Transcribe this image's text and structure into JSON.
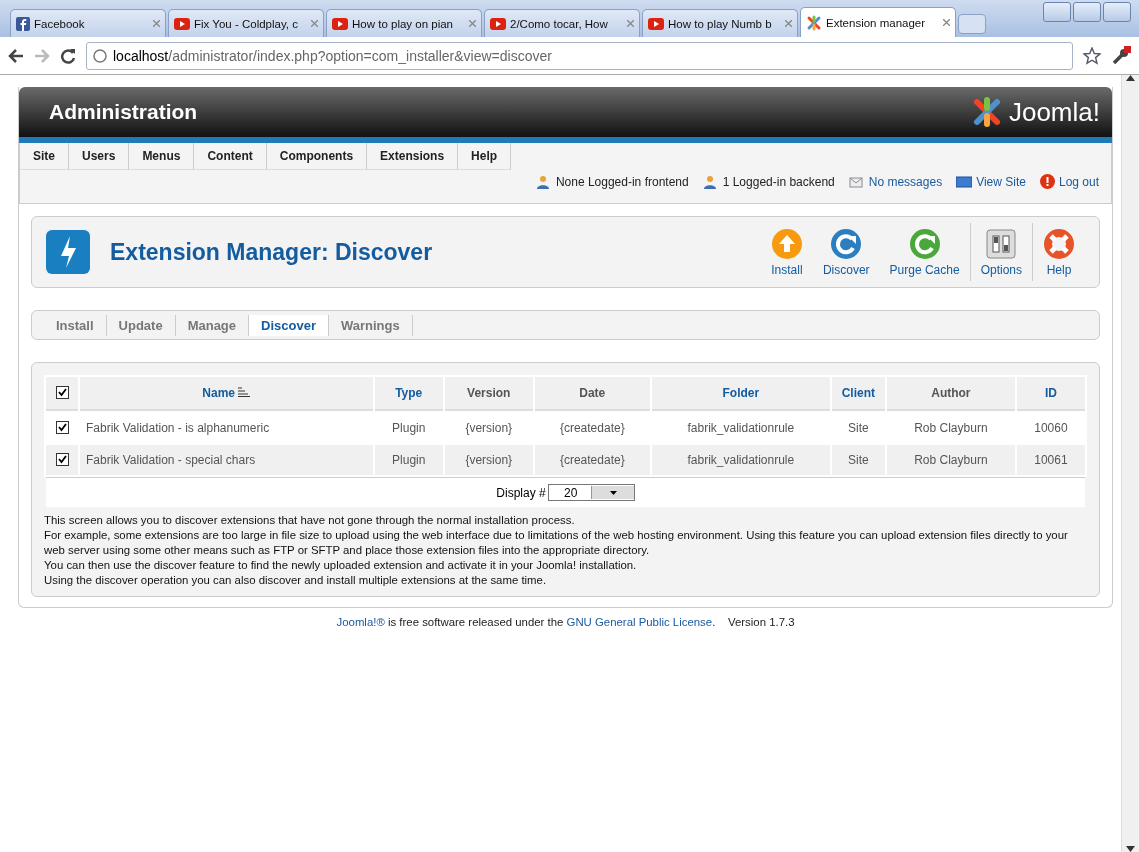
{
  "browser": {
    "tabs": [
      {
        "title": "Facebook",
        "kind": "facebook",
        "selected": false
      },
      {
        "title": "Fix You - Coldplay, c",
        "kind": "youtube",
        "selected": false
      },
      {
        "title": "How to play on pian",
        "kind": "youtube",
        "selected": false
      },
      {
        "title": "2/Como tocar, How",
        "kind": "youtube",
        "selected": false
      },
      {
        "title": "How to play Numb b",
        "kind": "youtube",
        "selected": false
      },
      {
        "title": "Extension manager",
        "kind": "joomla",
        "selected": true
      }
    ],
    "url_host": "localhost",
    "url_path": "/administrator/index.php?option=com_installer&view=discover"
  },
  "header": {
    "title": "Administration",
    "logo_text": "Joomla!"
  },
  "menu": [
    "Site",
    "Users",
    "Menus",
    "Content",
    "Components",
    "Extensions",
    "Help"
  ],
  "status": [
    {
      "text": "None Logged-in frontend",
      "kind": "users",
      "link": false
    },
    {
      "text": "1 Logged-in backend",
      "kind": "users",
      "link": false
    },
    {
      "text": "No messages",
      "kind": "mail",
      "link": true
    },
    {
      "text": "View Site",
      "kind": "screen",
      "link": true
    },
    {
      "text": "Log out",
      "kind": "logout",
      "link": true
    }
  ],
  "toolbar": {
    "title": "Extension Manager: Discover",
    "buttons": [
      {
        "label": "Install",
        "kind": "install"
      },
      {
        "label": "Discover",
        "kind": "discover"
      },
      {
        "label": "Purge Cache",
        "kind": "purge"
      },
      {
        "label": "Options",
        "kind": "options"
      },
      {
        "label": "Help",
        "kind": "help"
      }
    ]
  },
  "subtabs": [
    {
      "label": "Install",
      "selected": false
    },
    {
      "label": "Update",
      "selected": false
    },
    {
      "label": "Manage",
      "selected": false
    },
    {
      "label": "Discover",
      "selected": true
    },
    {
      "label": "Warnings",
      "selected": false
    }
  ],
  "table": {
    "all_checked": true,
    "columns": [
      {
        "label": "Name",
        "sortable": true,
        "sorted": true
      },
      {
        "label": "Type",
        "sortable": true,
        "sorted": false
      },
      {
        "label": "Version",
        "sortable": false,
        "sorted": false
      },
      {
        "label": "Date",
        "sortable": false,
        "sorted": false
      },
      {
        "label": "Folder",
        "sortable": true,
        "sorted": false
      },
      {
        "label": "Client",
        "sortable": true,
        "sorted": false
      },
      {
        "label": "Author",
        "sortable": false,
        "sorted": false
      },
      {
        "label": "ID",
        "sortable": true,
        "sorted": false
      }
    ],
    "rows": [
      {
        "checked": true,
        "cells": [
          "Fabrik Validation - is alphanumeric",
          "Plugin",
          "{version}",
          "{createdate}",
          "fabrik_validationrule",
          "Site",
          "Rob Clayburn",
          "10060"
        ]
      },
      {
        "checked": true,
        "cells": [
          "Fabrik Validation - special chars",
          "Plugin",
          "{version}",
          "{createdate}",
          "fabrik_validationrule",
          "Site",
          "Rob Clayburn",
          "10061"
        ]
      }
    ],
    "display_label": "Display #",
    "display_value": "20"
  },
  "description": [
    "This screen allows you to discover extensions that have not gone through the normal installation process.",
    "For example, some extensions are too large in file size to upload using the web interface due to limitations of the web hosting environment. Using this feature you can upload extension files directly to your web server using some other means such as FTP or SFTP and place those extension files into the appropriate directory.",
    "You can then use the discover feature to find the newly uploaded extension and activate it in your Joomla! installation.",
    "Using the discover operation you can also discover and install multiple extensions at the same time."
  ],
  "footer": {
    "link1": "Joomla!®",
    "middle": " is free software released under the ",
    "link2": "GNU General Public License",
    "end": ".",
    "version": "Version 1.7.3"
  }
}
